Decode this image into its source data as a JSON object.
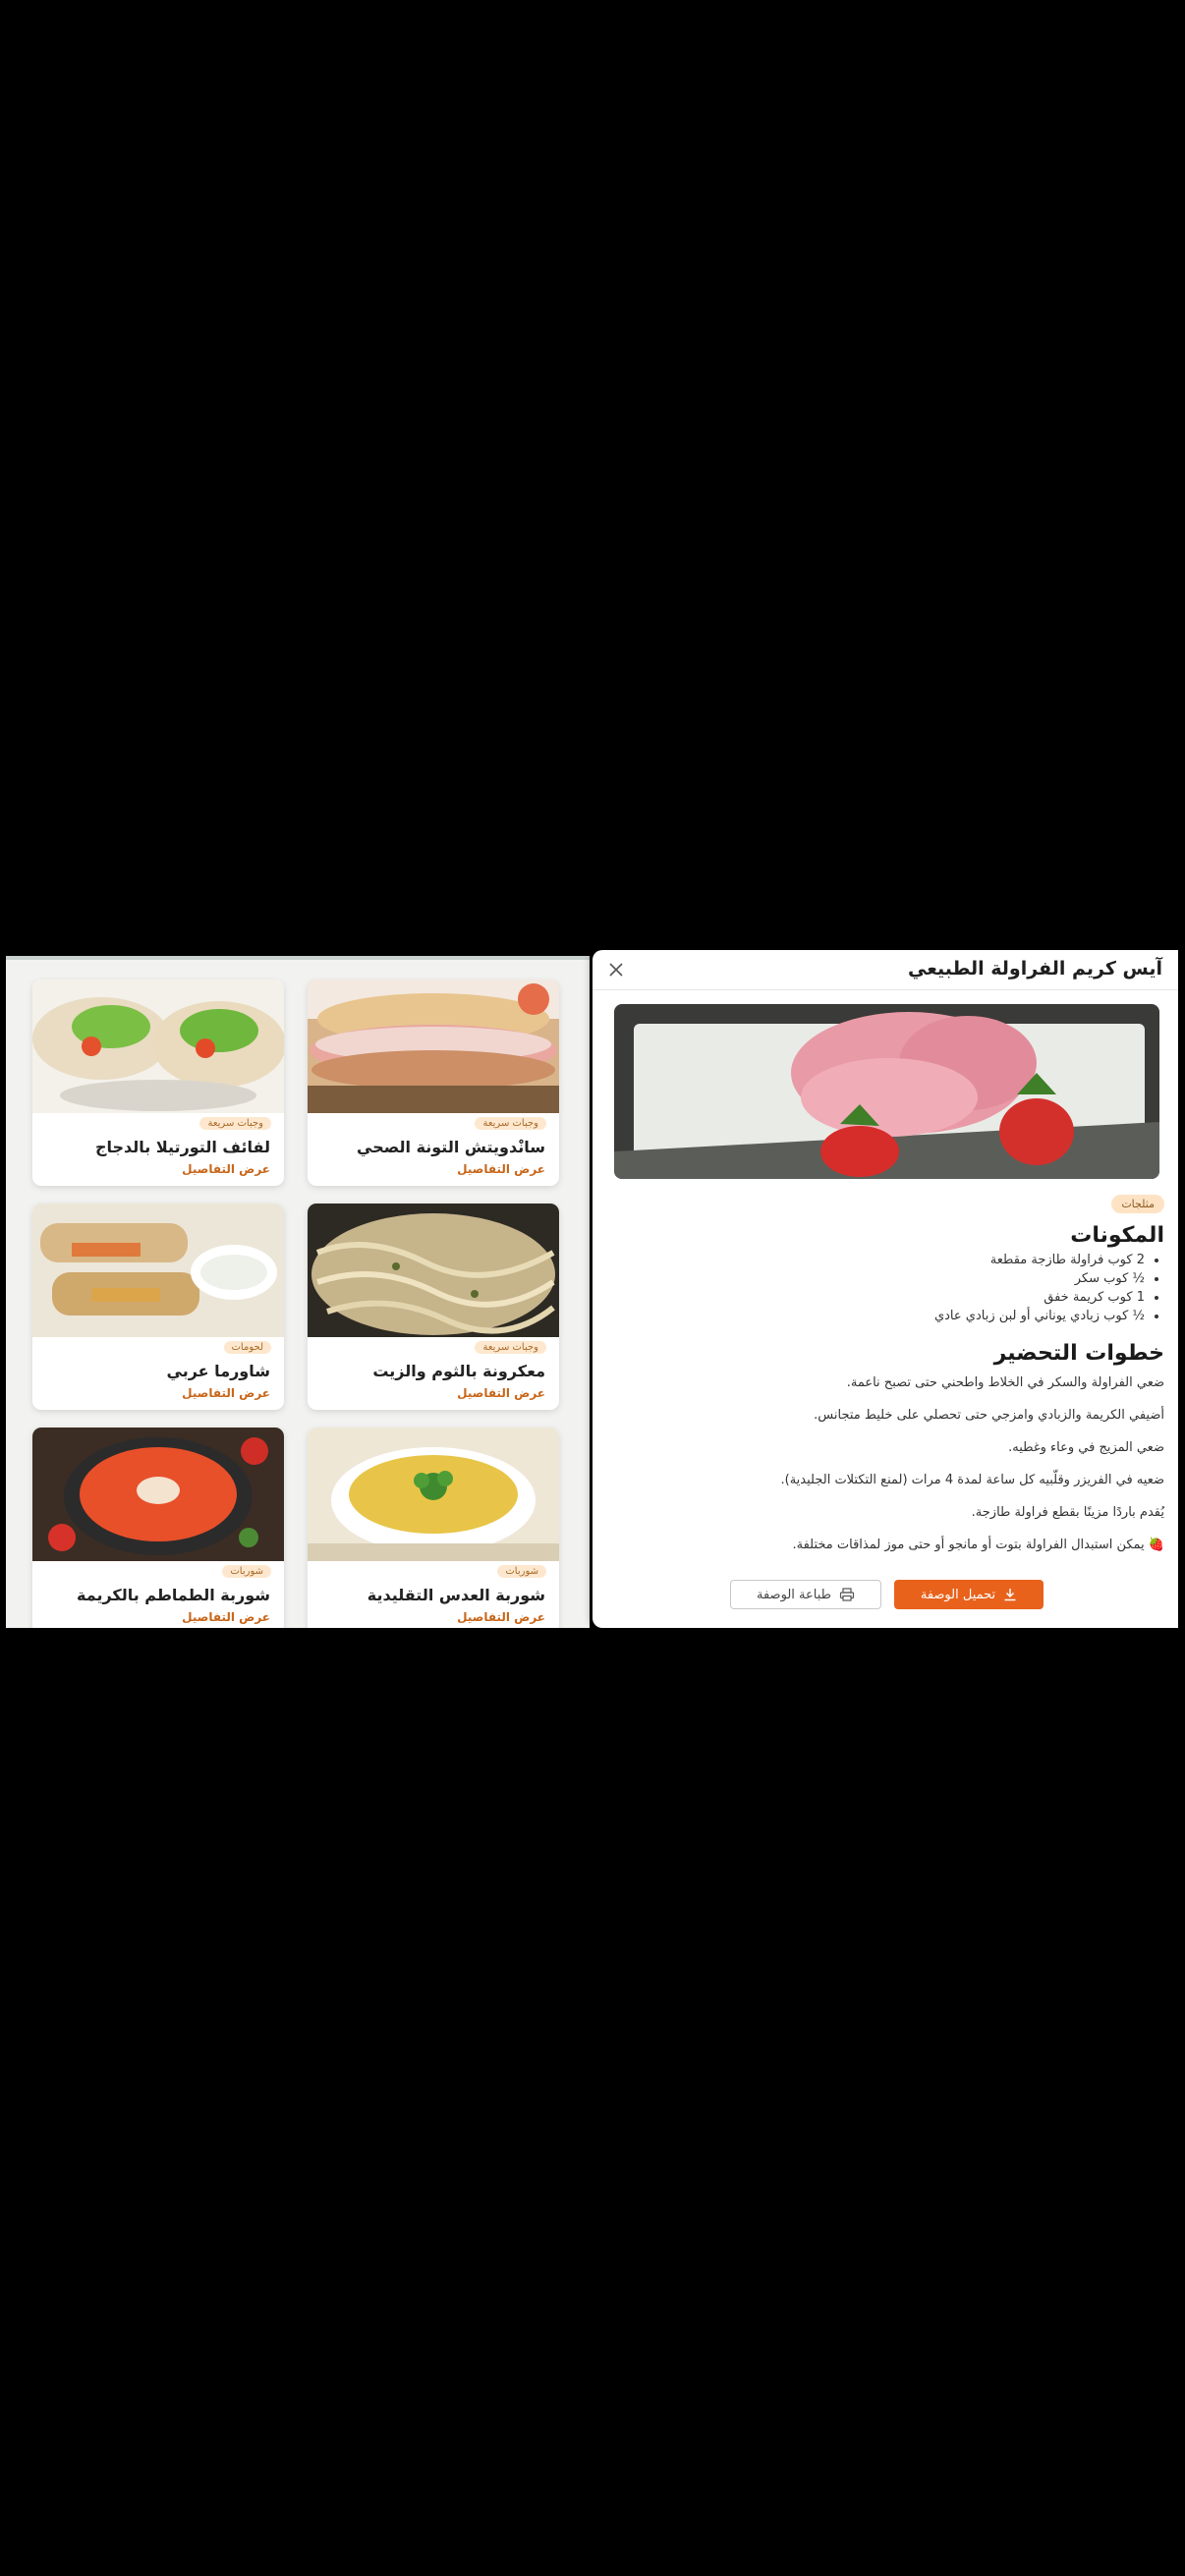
{
  "grid": {
    "cards": [
      {
        "title": "سانْدويتش التونة الصحي",
        "tag": "وجبات سريعة",
        "link": "عرض التفاصيل"
      },
      {
        "title": "لفائف التورتيلا بالدجاج",
        "tag": "وجبات سريعة",
        "link": "عرض التفاصيل"
      },
      {
        "title": "معكرونة بالثوم والزيت",
        "tag": "وجبات سريعة",
        "link": "عرض التفاصيل"
      },
      {
        "title": "شاورما عربي",
        "tag": "لحومات",
        "link": "عرض التفاصيل"
      },
      {
        "title": "شوربة العدس التقليدية",
        "tag": "شوربات",
        "link": "عرض التفاصيل"
      },
      {
        "title": "شوربة الطماطم بالكريمة",
        "tag": "شوربات",
        "link": "عرض التفاصيل"
      }
    ]
  },
  "modal": {
    "title": "آيس كريم الفراولة الطبيعي",
    "category_badge": "مثلجات",
    "ingredients_heading": "المكونات",
    "ingredients": [
      "2 كوب فراولة طازجة مقطعة",
      "½ كوب سكر",
      "1 كوب كريمة خفق",
      "½ كوب زبادي يوناني أو لبن زبادي عادي"
    ],
    "steps_heading": "خطوات التحضير",
    "steps": [
      "ضعي الفراولة والسكر في الخلاط واطحني حتى تصبح ناعمة.",
      "أضيفي الكريمة والزبادي وامزجي حتى تحصلي على خليط متجانس.",
      "ضعي المزيج في وعاء وغطيه.",
      "ضعيه في الفريزر وقلّبيه كل ساعة لمدة 4 مرات (لمنع التكتلات الجليدية).",
      "يُقدم باردًا مزينًا بقطع فراولة طازجة.",
      "🍓 يمكن استبدال الفراولة بتوت أو مانجو أو حتى موز لمذاقات مختلفة."
    ],
    "download_label": "تحميل الوصفة",
    "print_label": "طباعة الوصفة"
  },
  "colors": {
    "accent": "#e8621c",
    "badge_bg": "#fde3c4",
    "link": "#c8661a"
  },
  "icons": {
    "close": "close-icon",
    "download": "download-icon",
    "print": "printer-icon"
  }
}
